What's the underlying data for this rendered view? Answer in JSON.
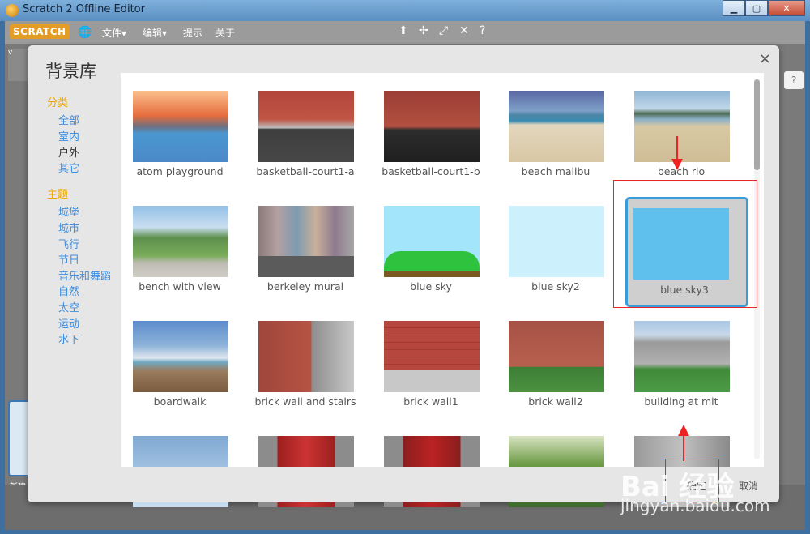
{
  "window": {
    "title": "Scratch 2 Offline Editor",
    "minimize": "▁",
    "maximize": "▢",
    "close": "✕"
  },
  "menubar": {
    "logo": "SCRATCH",
    "items": [
      "文件▾",
      "编辑▾",
      "提示",
      "关于"
    ]
  },
  "app": {
    "new_label": "新建",
    "left_mini_label": "v"
  },
  "dialog": {
    "title": "背景库",
    "close": "×",
    "category_header": "分类",
    "categories": [
      {
        "label": "全部",
        "selected": false
      },
      {
        "label": "室内",
        "selected": false
      },
      {
        "label": "户外",
        "selected": true
      },
      {
        "label": "其它",
        "selected": false
      }
    ],
    "theme_header": "主题",
    "themes": [
      "城堡",
      "城市",
      "飞行",
      "节日",
      "音乐和舞蹈",
      "自然",
      "太空",
      "运动",
      "水下"
    ],
    "items": [
      {
        "label": "atom playground",
        "thumb": "t-playground"
      },
      {
        "label": "basketball-court1-a",
        "thumb": "t-court-a"
      },
      {
        "label": "basketball-court1-b",
        "thumb": "t-court-b"
      },
      {
        "label": "beach malibu",
        "thumb": "t-malibu"
      },
      {
        "label": "beach rio",
        "thumb": "t-rio"
      },
      {
        "label": "bench with view",
        "thumb": "t-bench"
      },
      {
        "label": "berkeley mural",
        "thumb": "t-mural"
      },
      {
        "label": "blue sky",
        "thumb": "t-bluesky"
      },
      {
        "label": "blue sky2",
        "thumb": "t-bluesky2"
      },
      {
        "label": "blue sky3",
        "thumb": "t-bluesky3",
        "selected": true
      },
      {
        "label": "boardwalk",
        "thumb": "t-boardwalk"
      },
      {
        "label": "brick wall and stairs",
        "thumb": "t-brickstairs"
      },
      {
        "label": "brick wall1",
        "thumb": "t-brickwall1"
      },
      {
        "label": "brick wall2",
        "thumb": "t-brickwall2"
      },
      {
        "label": "building at mit",
        "thumb": "t-mit"
      },
      {
        "label": "",
        "thumb": "t-row4a"
      },
      {
        "label": "",
        "thumb": "t-row4b"
      },
      {
        "label": "",
        "thumb": "t-row4c"
      },
      {
        "label": "",
        "thumb": "t-row4d"
      },
      {
        "label": "",
        "thumb": "t-row4e"
      }
    ],
    "ok_label": "确定",
    "cancel_label": "取消"
  },
  "watermark": {
    "brand": "Bai 经验",
    "url": "jingyan.baidu.com"
  },
  "colors": {
    "accent": "#3a9bd6",
    "category_header": "#f0a500",
    "category_link": "#3f8ee0",
    "annotation": "#ee2222"
  }
}
